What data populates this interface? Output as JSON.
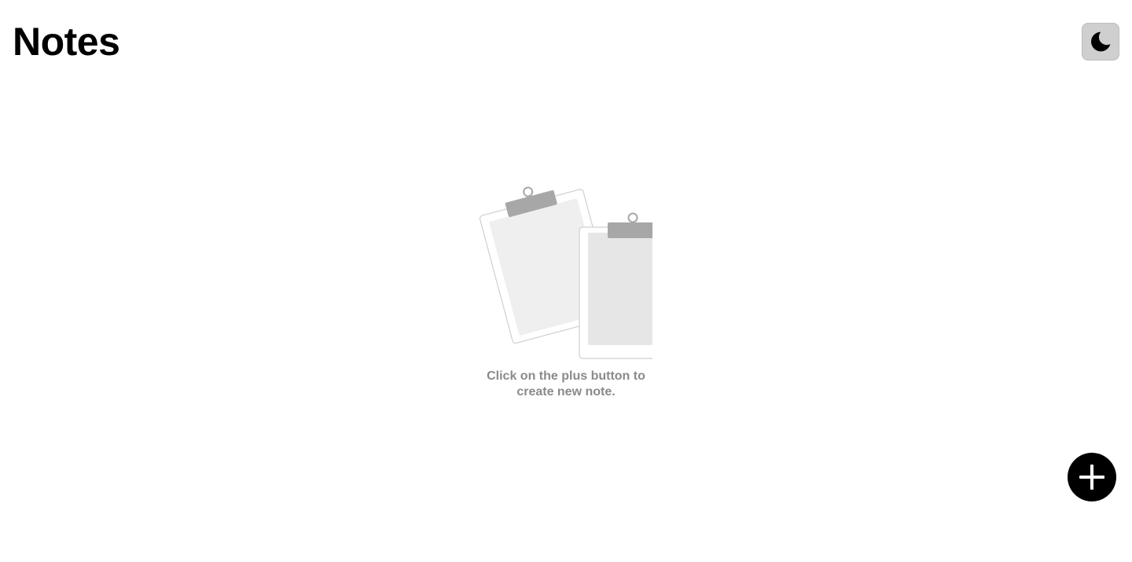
{
  "header": {
    "title": "Notes",
    "theme_toggle_icon": "moon-icon"
  },
  "empty_state": {
    "illustration_icon": "clipboards-icon",
    "message": "Click on the plus button to create new note."
  },
  "fab": {
    "icon": "plus-icon"
  },
  "colors": {
    "background": "#ffffff",
    "title": "#000000",
    "toggle_bg": "#cfcfcf",
    "empty_text": "#8a8a8a",
    "fab_bg": "#000000",
    "fab_icon": "#ffffff"
  }
}
